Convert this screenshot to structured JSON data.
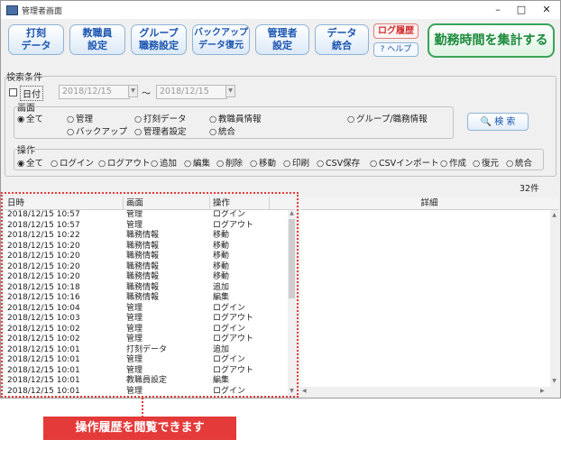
{
  "window": {
    "title": "管理者画面",
    "minimize": "–",
    "maximize": "□",
    "close": "✕"
  },
  "toolbar": {
    "buttons": [
      {
        "line1": "打刻",
        "line2": "データ"
      },
      {
        "line1": "教職員",
        "line2": "設定"
      },
      {
        "line1": "グループ",
        "line2": "職務設定"
      },
      {
        "line1": "バックアップ",
        "line2": "データ復元"
      },
      {
        "line1": "管理者",
        "line2": "設定"
      },
      {
        "line1": "データ",
        "line2": "統合"
      }
    ],
    "log_history": "ログ履歴",
    "help": "? ヘルプ",
    "aggregate": "勤務時間を集計する"
  },
  "search": {
    "title": "検索条件",
    "date_label": "日付",
    "date_from": "2018/12/15",
    "date_to": "2018/12/15",
    "tilde": "～",
    "screen_label": "画面",
    "screen_options": [
      "全て",
      "管理",
      "打刻データ",
      "教職員情報",
      "グループ/職務情報",
      "バックアップ",
      "管理者設定",
      "統合"
    ],
    "search_button": "検 索",
    "operation_label": "操作",
    "operation_options": [
      "全て",
      "ログイン",
      "ログアウト",
      "追加",
      "編集",
      "削除",
      "移動",
      "印刷",
      "CSV保存",
      "CSVインポート",
      "作成",
      "復元",
      "統合"
    ]
  },
  "count": "32件",
  "log_table": {
    "columns": [
      "日時",
      "画面",
      "操作"
    ],
    "rows": [
      [
        "2018/12/15 10:57",
        "管理",
        "ログイン"
      ],
      [
        "2018/12/15 10:57",
        "管理",
        "ログアウト"
      ],
      [
        "2018/12/15 10:22",
        "職務情報",
        "移動"
      ],
      [
        "2018/12/15 10:20",
        "職務情報",
        "移動"
      ],
      [
        "2018/12/15 10:20",
        "職務情報",
        "移動"
      ],
      [
        "2018/12/15 10:20",
        "職務情報",
        "移動"
      ],
      [
        "2018/12/15 10:20",
        "職務情報",
        "移動"
      ],
      [
        "2018/12/15 10:18",
        "職務情報",
        "追加"
      ],
      [
        "2018/12/15 10:16",
        "職務情報",
        "編集"
      ],
      [
        "2018/12/15 10:04",
        "管理",
        "ログイン"
      ],
      [
        "2018/12/15 10:03",
        "管理",
        "ログアウト"
      ],
      [
        "2018/12/15 10:02",
        "管理",
        "ログイン"
      ],
      [
        "2018/12/15 10:02",
        "管理",
        "ログアウト"
      ],
      [
        "2018/12/15 10:01",
        "打刻データ",
        "追加"
      ],
      [
        "2018/12/15 10:01",
        "管理",
        "ログイン"
      ],
      [
        "2018/12/15 10:01",
        "管理",
        "ログアウト"
      ],
      [
        "2018/12/15 10:01",
        "教職員設定",
        "編集"
      ],
      [
        "2018/12/15 10:01",
        "管理",
        "ログイン"
      ]
    ]
  },
  "detail_table": {
    "header": "詳細"
  },
  "callout": "操作履歴を閲覧できます"
}
